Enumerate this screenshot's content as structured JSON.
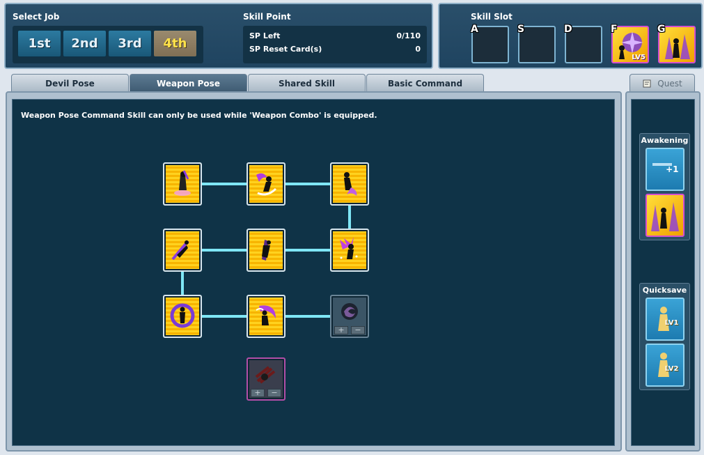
{
  "select_job": {
    "title": "Select Job",
    "tabs": [
      "1st",
      "2nd",
      "3rd",
      "4th"
    ],
    "active": "4th"
  },
  "skill_point": {
    "title": "Skill Point",
    "rows": [
      {
        "label": "SP Left",
        "value": "0/110"
      },
      {
        "label": "SP Reset Card(s)",
        "value": "0"
      }
    ]
  },
  "skill_slot": {
    "title": "Skill Slot",
    "slots": [
      {
        "key": "A",
        "filled": false,
        "level": ""
      },
      {
        "key": "S",
        "filled": false,
        "level": ""
      },
      {
        "key": "D",
        "filled": false,
        "level": ""
      },
      {
        "key": "F",
        "filled": true,
        "level": "LV5"
      },
      {
        "key": "G",
        "filled": true,
        "level": ""
      }
    ]
  },
  "tabs": [
    "Devil Pose",
    "Weapon Pose",
    "Shared Skill",
    "Basic Command"
  ],
  "active_tab": "Weapon Pose",
  "notice": "Weapon Pose Command Skill can only be used while 'Weapon Combo' is equipped.",
  "skill_nodes": [
    {
      "name": "skill-node-1",
      "state": "learned",
      "icon": "upward-slash-icon"
    },
    {
      "name": "skill-node-2",
      "state": "learned",
      "icon": "purple-swing-icon"
    },
    {
      "name": "skill-node-3",
      "state": "learned",
      "icon": "spin-strike-icon"
    },
    {
      "name": "skill-node-4",
      "state": "learned",
      "icon": "dash-strike-icon"
    },
    {
      "name": "skill-node-5",
      "state": "learned",
      "icon": "rising-blade-icon"
    },
    {
      "name": "skill-node-6",
      "state": "learned",
      "icon": "purple-burst-icon"
    },
    {
      "name": "skill-node-7",
      "state": "learned",
      "icon": "ring-aura-icon"
    },
    {
      "name": "skill-node-8",
      "state": "learned",
      "icon": "crescent-slash-icon"
    },
    {
      "name": "skill-node-9",
      "state": "locked",
      "icon": "dark-vortex-icon"
    },
    {
      "name": "skill-node-10",
      "state": "locked",
      "icon": "shadow-claw-icon"
    }
  ],
  "node_controls": {
    "plus": "+",
    "minus": "−"
  },
  "quest": {
    "label": "Quest"
  },
  "awakening": {
    "title": "Awakening",
    "plus_label": "+1"
  },
  "quicksave": {
    "title": "Quicksave",
    "slots": [
      "LV1",
      "LV2"
    ]
  }
}
